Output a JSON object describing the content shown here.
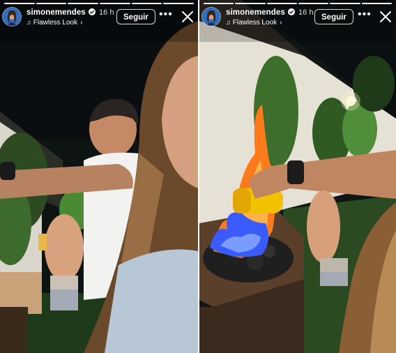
{
  "stories": [
    {
      "username": "simonemendes",
      "time": "16 h",
      "music": "Flawless Look",
      "follow_label": "Seguir",
      "more_icon": "more-horizontal-icon",
      "close_icon": "close-icon",
      "progress": [
        1.0,
        1.0,
        1.0,
        1.0,
        1.0,
        1.0
      ]
    },
    {
      "username": "simonemendes",
      "time": "16 h",
      "music": "Flawless Look",
      "follow_label": "Seguir",
      "more_icon": "more-horizontal-icon",
      "close_icon": "close-icon",
      "progress": [
        1.0,
        1.0,
        1.0,
        1.0,
        1.0,
        1.0
      ]
    }
  ],
  "colors": {
    "overlay_text": "#ffffff",
    "flame": "#ff7a1a",
    "flame_blue": "#3a5cff",
    "lighter": "#f2c200"
  }
}
